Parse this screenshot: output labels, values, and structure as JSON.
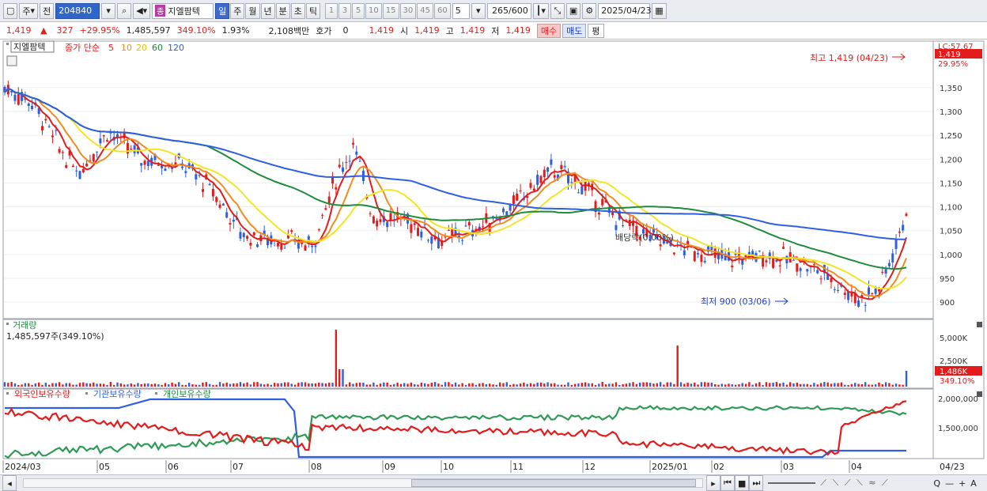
{
  "toolbar": {
    "market_label": "주",
    "mode_label": "전",
    "stock_code": "204840",
    "stock_name_badge": "종",
    "stock_name": "지엘팜텍",
    "period_buttons": [
      "일",
      "주",
      "월",
      "년",
      "분",
      "초",
      "틱"
    ],
    "active_period": "일",
    "interval_buttons": [
      "1",
      "3",
      "5",
      "10",
      "15",
      "30",
      "45",
      "60"
    ],
    "interval_value": "5",
    "count_value": "265",
    "count_max": "/600",
    "date_value": "2025/04/23"
  },
  "quote": {
    "price": "1,419",
    "change": "327",
    "change_pct": "+29.95%",
    "volume": "1,485,597",
    "volume_ratio": "349.10%",
    "turnover_pct": "1.93%",
    "amount": "2,108백만",
    "bid_label": "호가",
    "bid_value": "0",
    "current_price": "1,419",
    "open_label": "시",
    "open": "1,419",
    "high_label": "고",
    "high": "1,419",
    "low_label": "저",
    "low": "1,419",
    "buy_label": "매수",
    "sell_label": "매도",
    "flat_label": "평"
  },
  "price_panel": {
    "name_tag": "지엘팜텍",
    "ma_label": "종가 단순",
    "ma_periods": [
      "5",
      "10",
      "20",
      "60",
      "120"
    ],
    "ma_colors": [
      "#e31b1b",
      "#f08c1e",
      "#f2e526",
      "#1e8c3c",
      "#2f5fe0"
    ],
    "high_annotation": "최고 1,419 (04/23)",
    "low_annotation": "최저 900 (03/06)",
    "dividend_annotation": "배당락(0.00%)",
    "right_top_label": "LC:57.67",
    "right_price_tag": "1,419",
    "right_pct_tag": "29.95%",
    "y_ticks": [
      "1,350",
      "1,300",
      "1,250",
      "1,200",
      "1,150",
      "1,100",
      "1,050",
      "1,000",
      "950",
      "900"
    ]
  },
  "volume_panel": {
    "title": "거래량",
    "value_label": "1,485,597주(349.10%)",
    "y_ticks": [
      "5,000K",
      "2,500K"
    ],
    "right_tag": "1,486K",
    "right_pct": "349.10%"
  },
  "holdings_panel": {
    "legend": [
      "외국인보유수량",
      "기관보유수량",
      "개인보유수량"
    ],
    "legend_colors": [
      "#e31b1b",
      "#2f5fe0",
      "#1e8c3c"
    ],
    "y_ticks": [
      "2,000,000",
      "1,500,000"
    ]
  },
  "x_axis": {
    "labels": [
      "2024/03",
      "05",
      "06",
      "07",
      "08",
      "09",
      "10",
      "11",
      "12",
      "2025/01",
      "02",
      "03",
      "04"
    ],
    "right_label": "04/23"
  },
  "statusbar": {
    "zoom_symbols": [
      "Q",
      "—",
      "+",
      "A"
    ]
  }
}
